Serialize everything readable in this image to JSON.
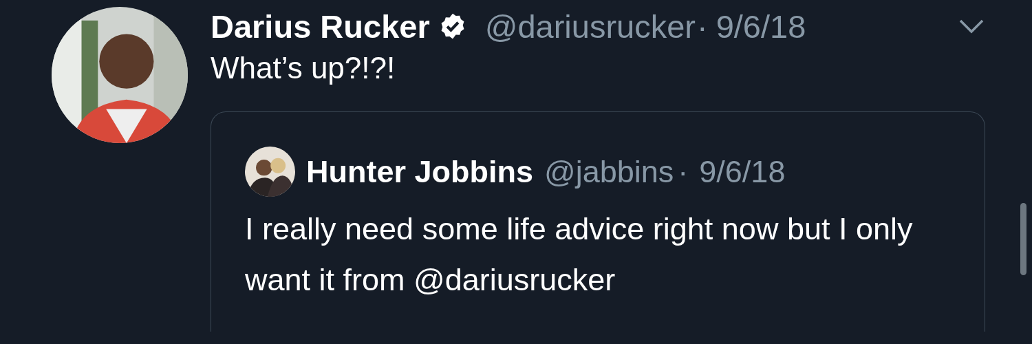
{
  "tweet": {
    "author": "Darius Rucker",
    "verified": true,
    "handle": "@dariusrucker",
    "separator": "·",
    "date": "9/6/18",
    "text": "What’s up?!?!",
    "quote": {
      "author": "Hunter Jobbins",
      "handle": "@jabbins",
      "separator": "·",
      "date": "9/6/18",
      "text": "I really need some life advice right now but I only want it from @dariusrucker"
    }
  }
}
